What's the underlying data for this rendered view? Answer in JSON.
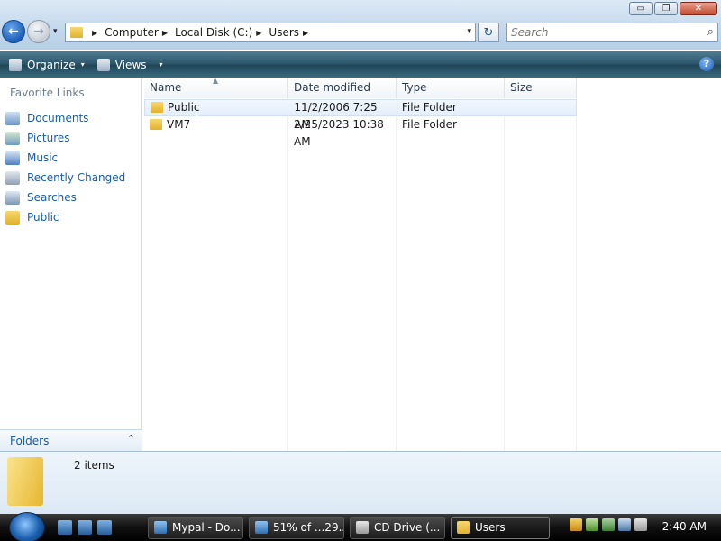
{
  "window": {
    "minimize_glyph": "▭",
    "maximize_glyph": "❐",
    "close_glyph": "✕"
  },
  "nav": {
    "back_glyph": "←",
    "forward_glyph": "→",
    "recent_glyph": "▾"
  },
  "address": {
    "crumbs": [
      "Computer",
      "Local Disk (C:)",
      "Users"
    ],
    "dropdown_glyph": "▾"
  },
  "refresh_glyph": "↻",
  "search": {
    "placeholder": "Search"
  },
  "commandbar": {
    "organize": "Organize",
    "views": "Views",
    "arrow_glyph": "▾",
    "help_glyph": "?"
  },
  "favorites": {
    "title": "Favorite Links",
    "items": [
      {
        "label": "Documents",
        "icon": "documents-icon"
      },
      {
        "label": "Pictures",
        "icon": "pictures-icon"
      },
      {
        "label": "Music",
        "icon": "music-icon"
      },
      {
        "label": "Recently Changed",
        "icon": "recently-changed-icon"
      },
      {
        "label": "Searches",
        "icon": "searches-icon"
      },
      {
        "label": "Public",
        "icon": "folder-icon"
      }
    ]
  },
  "folders_bar": {
    "label": "Folders",
    "chevron": "⌃"
  },
  "columns": [
    "Name",
    "Date modified",
    "Type",
    "Size"
  ],
  "sort_glyph": "▲",
  "files": [
    {
      "name": "Public",
      "date": "11/2/2006 7:25 AM",
      "type": "File Folder",
      "size": "",
      "selected": true
    },
    {
      "name": "VM7",
      "date": "2/25/2023 10:38 AM",
      "type": "File Folder",
      "size": "",
      "selected": false
    }
  ],
  "details": {
    "count": "2 items"
  },
  "taskbar": {
    "tasks": [
      {
        "label": "Mypal - Do...",
        "active": false
      },
      {
        "label": "51% of ...29...",
        "active": false
      },
      {
        "label": "CD Drive (...",
        "active": false
      },
      {
        "label": "Users",
        "active": true
      }
    ],
    "clock": "2:40 AM"
  },
  "colors": {
    "link": "#1a5ca8",
    "cmdbar": "#2a5368",
    "taskbar": "#101010"
  }
}
